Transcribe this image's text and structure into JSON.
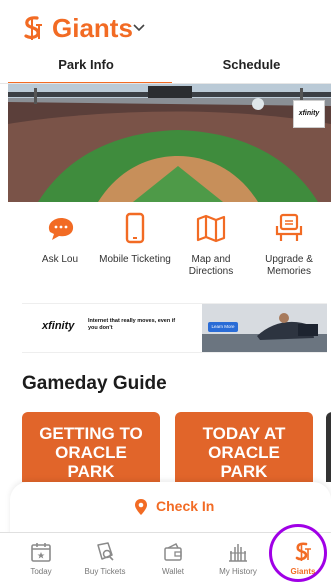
{
  "header": {
    "team_name": "Giants",
    "logo_text": "SF"
  },
  "tabs": [
    {
      "label": "Park Info",
      "active": true
    },
    {
      "label": "Schedule",
      "active": false
    }
  ],
  "hero": {
    "sponsor": "xfinity"
  },
  "actions": [
    {
      "label": "Ask Lou",
      "icon": "chat-bubble-icon"
    },
    {
      "label": "Mobile Ticketing",
      "icon": "phone-icon"
    },
    {
      "label": "Map and Directions",
      "icon": "map-icon"
    },
    {
      "label": "Upgrade & Memories",
      "icon": "seat-icon"
    }
  ],
  "ad": {
    "brand": "xfinity",
    "copy": "Internet that really moves, even if you don't",
    "button": "Learn More"
  },
  "gameday": {
    "title": "Gameday Guide",
    "cards": [
      {
        "line1": "GETTING TO",
        "line2": "ORACLE",
        "line3": "PARK"
      },
      {
        "line1": "TODAY AT",
        "line2": "ORACLE",
        "line3": "PARK"
      }
    ]
  },
  "checkin": {
    "label": "Check In"
  },
  "nav": [
    {
      "label": "Today",
      "icon": "calendar-icon"
    },
    {
      "label": "Buy Tickets",
      "icon": "ticket-icon"
    },
    {
      "label": "Wallet",
      "icon": "wallet-icon"
    },
    {
      "label": "My History",
      "icon": "stadium-icon"
    },
    {
      "label": "Giants",
      "icon": "giants-logo-icon",
      "active": true
    }
  ],
  "colors": {
    "accent": "#f26b24",
    "highlight_ring": "#a000e6"
  }
}
